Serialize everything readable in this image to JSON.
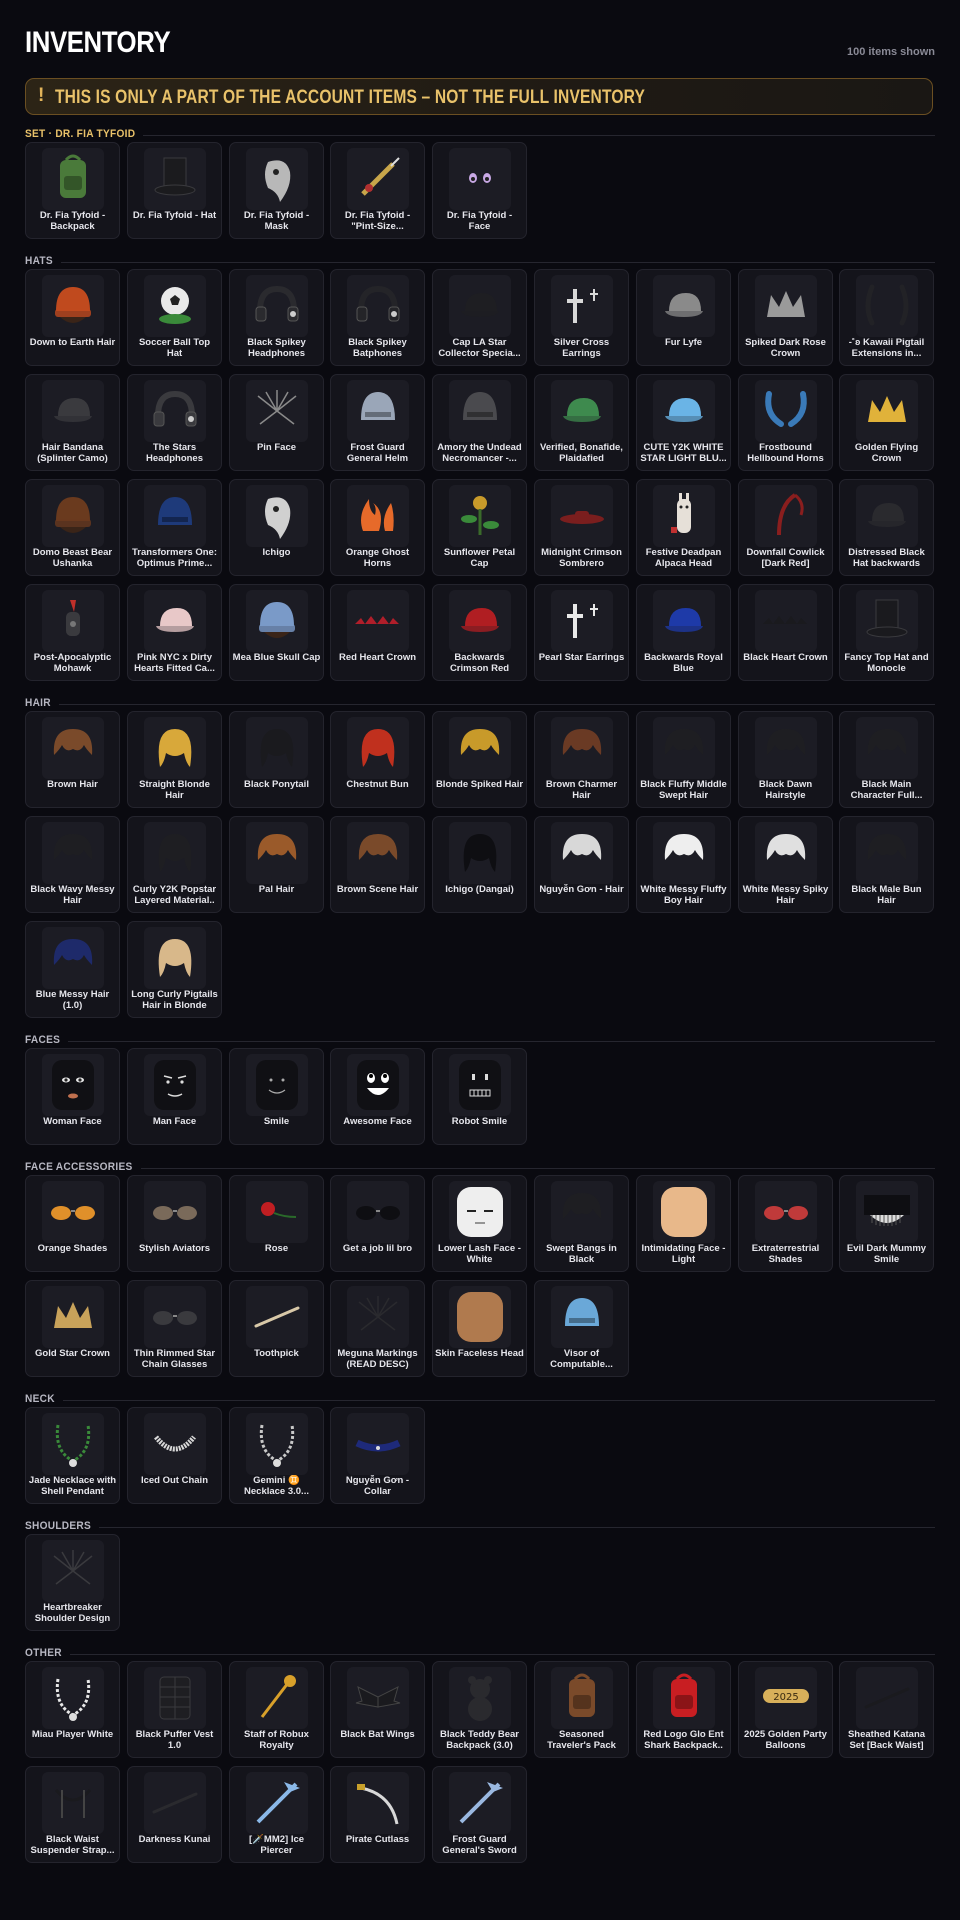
{
  "header": {
    "title": "INVENTORY",
    "count": "100 items shown"
  },
  "banner": {
    "icon": "!",
    "text": "THIS IS ONLY A PART OF THE ACCOUNT ITEMS – NOT THE FULL INVENTORY",
    "color": "#e9c26a"
  },
  "sections": [
    {
      "label": "SET · DR. FIA TYFOID",
      "highlight": true,
      "items": [
        {
          "name": "Dr. Fia Tyfoid - Backpack",
          "icon": "backpack",
          "c": "#4a7a3a"
        },
        {
          "name": "Dr. Fia Tyfoid - Hat",
          "icon": "tophat",
          "c": "#1b1b1e"
        },
        {
          "name": "Dr. Fia Tyfoid - Mask",
          "icon": "mask",
          "c": "#b8b8b8"
        },
        {
          "name": "Dr. Fia Tyfoid - \"Pint-Size...",
          "icon": "syringe",
          "c": "#c8a64a"
        },
        {
          "name": "Dr. Fia Tyfoid - Face",
          "icon": "face-eyes",
          "c": "#c9a9e6"
        }
      ]
    },
    {
      "label": "HATS",
      "highlight": false,
      "items": [
        {
          "name": "Down to Earth Hair",
          "icon": "beanie",
          "c": "#c04a1e"
        },
        {
          "name": "Soccer Ball Top Hat",
          "icon": "ball",
          "c": "#e9e9e9"
        },
        {
          "name": "Black Spikey Headphones",
          "icon": "headphones",
          "c": "#2a2a2e"
        },
        {
          "name": "Black Spikey Batphones",
          "icon": "headphones",
          "c": "#242428"
        },
        {
          "name": "Cap LA Star Collector Specia...",
          "icon": "cap",
          "c": "#1e1e22"
        },
        {
          "name": "Silver Cross Earrings",
          "icon": "cross",
          "c": "#d8d8d8"
        },
        {
          "name": "Fur Lyfe",
          "icon": "cap",
          "c": "#8a8a8a"
        },
        {
          "name": "Spiked Dark Rose Crown",
          "icon": "crown",
          "c": "#9a9a9a"
        },
        {
          "name": "-˚ʚ Kawaii Pigtail Extensions in...",
          "icon": "pigtails",
          "c": "#222226"
        },
        {
          "name": "Hair Bandana (Splinter Camo)",
          "icon": "cap",
          "c": "#3a3a3e"
        },
        {
          "name": "The Stars Headphones",
          "icon": "headphones",
          "c": "#3a3a3e"
        },
        {
          "name": "Pin Face",
          "icon": "lines",
          "c": "#8a8a8a"
        },
        {
          "name": "Frost Guard General Helm",
          "icon": "helm",
          "c": "#9aa6b8"
        },
        {
          "name": "Amory the Undead Necromancer -...",
          "icon": "helm",
          "c": "#4a4a4e"
        },
        {
          "name": "Verified, Bonafide, Plaidafied",
          "icon": "cap",
          "c": "#3e8a4e"
        },
        {
          "name": "CUTE Y2K WHITE STAR LIGHT BLU...",
          "icon": "cap",
          "c": "#6ab4e6"
        },
        {
          "name": "Frostbound Hellbound Horns",
          "icon": "horns",
          "c": "#3a7ab8"
        },
        {
          "name": "Golden Flying Crown",
          "icon": "crown",
          "c": "#e0b23a"
        },
        {
          "name": "Domo Beast Bear Ushanka",
          "icon": "beanie",
          "c": "#6a3a1e"
        },
        {
          "name": "Transformers One: Optimus Prime...",
          "icon": "helm",
          "c": "#1e3a7a"
        },
        {
          "name": "Ichigo",
          "icon": "mask",
          "c": "#d0d0d0"
        },
        {
          "name": "Orange Ghost Horns",
          "icon": "flame",
          "c": "#e66a2a"
        },
        {
          "name": "Sunflower Petal Cap",
          "icon": "plant",
          "c": "#3a8a3a"
        },
        {
          "name": "Midnight Crimson Sombrero",
          "icon": "hat-flat",
          "c": "#7a1e1e"
        },
        {
          "name": "Festive Deadpan Alpaca Head",
          "icon": "alpaca",
          "c": "#e6e0d8"
        },
        {
          "name": "Downfall Cowlick [Dark Red]",
          "icon": "scythe",
          "c": "#8a1e1e"
        },
        {
          "name": "Distressed Black Hat backwards",
          "icon": "cap",
          "c": "#2a2a2e"
        },
        {
          "name": "Post-Apocalyptic Mohawk",
          "icon": "mohawk",
          "c": "#c0302a"
        },
        {
          "name": "Pink NYC x Dirty Hearts Fitted Ca...",
          "icon": "cap",
          "c": "#e8c8c8"
        },
        {
          "name": "Mea Blue Skull Cap",
          "icon": "beanie",
          "c": "#7a9ac8"
        },
        {
          "name": "Red Heart Crown",
          "icon": "spikes",
          "c": "#b01e2a"
        },
        {
          "name": "Backwards Crimson Red",
          "icon": "cap",
          "c": "#b01e22"
        },
        {
          "name": "Pearl Star Earrings",
          "icon": "cross",
          "c": "#e8e8e8"
        },
        {
          "name": "Backwards Royal Blue",
          "icon": "cap",
          "c": "#1e3aa8"
        },
        {
          "name": "Black Heart Crown",
          "icon": "spikes",
          "c": "#1a1a1e"
        },
        {
          "name": "Fancy Top Hat and Monocle",
          "icon": "tophat",
          "c": "#1a1a1e"
        }
      ]
    },
    {
      "label": "HAIR",
      "highlight": false,
      "items": [
        {
          "name": "Brown Hair",
          "icon": "hair",
          "c": "#7a4a2a"
        },
        {
          "name": "Straight Blonde Hair",
          "icon": "hair-long",
          "c": "#d8a83a"
        },
        {
          "name": "Black Ponytail",
          "icon": "hair-long",
          "c": "#1a1a1e"
        },
        {
          "name": "Chestnut Bun",
          "icon": "hair-long",
          "c": "#c0301e"
        },
        {
          "name": "Blonde Spiked Hair",
          "icon": "hair",
          "c": "#c89a2a"
        },
        {
          "name": "Brown Charmer Hair",
          "icon": "hair",
          "c": "#6a3a24"
        },
        {
          "name": "Black Fluffy Middle Swept Hair",
          "icon": "hair",
          "c": "#1e1e22"
        },
        {
          "name": "Black Dawn Hairstyle",
          "icon": "hair",
          "c": "#1e1e22"
        },
        {
          "name": "Black Main Character Full...",
          "icon": "hair",
          "c": "#1e1e22"
        },
        {
          "name": "Black Wavy Messy Hair",
          "icon": "hair",
          "c": "#1e1e22"
        },
        {
          "name": "Curly Y2K Popstar Layered Material..",
          "icon": "hair-long",
          "c": "#1e1e22"
        },
        {
          "name": "Pal Hair",
          "icon": "hair",
          "c": "#9a5a2a"
        },
        {
          "name": "Brown Scene Hair",
          "icon": "hair",
          "c": "#7a4a2a"
        },
        {
          "name": "Ichigo (Dangai)",
          "icon": "hair-long",
          "c": "#0e0e12"
        },
        {
          "name": "Nguyễn Gơn - Hair",
          "icon": "hair",
          "c": "#d8d8d8"
        },
        {
          "name": "White Messy Fluffy Boy Hair",
          "icon": "hair",
          "c": "#eeeeee"
        },
        {
          "name": "White Messy Spiky Hair",
          "icon": "hair",
          "c": "#e0e0e0"
        },
        {
          "name": "Black Male Bun Hair",
          "icon": "hair",
          "c": "#1e1e22"
        },
        {
          "name": "Blue Messy Hair (1.0)",
          "icon": "hair",
          "c": "#1e2a6a"
        },
        {
          "name": "Long Curly Pigtails Hair in Blonde",
          "icon": "hair-long",
          "c": "#d8b88a"
        }
      ]
    },
    {
      "label": "FACES",
      "highlight": false,
      "items": [
        {
          "name": "Woman Face",
          "icon": "face-woman",
          "c": "#101014"
        },
        {
          "name": "Man Face",
          "icon": "face-man",
          "c": "#101014"
        },
        {
          "name": "Smile",
          "icon": "face-smile",
          "c": "#101014"
        },
        {
          "name": "Awesome Face",
          "icon": "face-awesome",
          "c": "#101014"
        },
        {
          "name": "Robot Smile",
          "icon": "face-robot",
          "c": "#101014"
        }
      ]
    },
    {
      "label": "FACE ACCESSORIES",
      "highlight": false,
      "items": [
        {
          "name": "Orange Shades",
          "icon": "glasses",
          "c": "#e0902a"
        },
        {
          "name": "Stylish Aviators",
          "icon": "glasses",
          "c": "#7a6a5a"
        },
        {
          "name": "Rose",
          "icon": "rose",
          "c": "#c01e22"
        },
        {
          "name": "Get a job lil bro",
          "icon": "glasses",
          "c": "#0e0e12"
        },
        {
          "name": "Lower Lash Face - White",
          "icon": "head-white",
          "c": "#eeeeee"
        },
        {
          "name": "Swept Bangs in Black",
          "icon": "hair",
          "c": "#1e1e22"
        },
        {
          "name": "Intimidating Face - Light",
          "icon": "head-skin",
          "c": "#e8b88a"
        },
        {
          "name": "Extraterrestrial Shades",
          "icon": "glasses",
          "c": "#c03a3a"
        },
        {
          "name": "Evil Dark Mummy Smile",
          "icon": "mummy",
          "c": "#0e0e12"
        },
        {
          "name": "Gold Star Crown",
          "icon": "crown",
          "c": "#c8a25a"
        },
        {
          "name": "Thin Rimmed Star Chain Glasses",
          "icon": "glasses",
          "c": "#3a3a3e"
        },
        {
          "name": "Toothpick",
          "icon": "stick",
          "c": "#d8c8a8"
        },
        {
          "name": "Meguna Markings (READ DESC)",
          "icon": "lines",
          "c": "#2a2a2e"
        },
        {
          "name": "Skin Faceless Head",
          "icon": "head-skin",
          "c": "#b07a4e"
        },
        {
          "name": "Visor of Computable...",
          "icon": "helm",
          "c": "#6aa8d8"
        }
      ]
    },
    {
      "label": "NECK",
      "highlight": false,
      "items": [
        {
          "name": "Jade Necklace with Shell Pendant",
          "icon": "necklace",
          "c": "#3a8a3a"
        },
        {
          "name": "Iced Out Chain",
          "icon": "chain",
          "c": "#d8d8d8"
        },
        {
          "name": "Gemini ♊ Necklace 3.0...",
          "icon": "necklace",
          "c": "#c8c8c8"
        },
        {
          "name": "Nguyễn Gơn - Collar",
          "icon": "collar",
          "c": "#1e2a7a"
        }
      ]
    },
    {
      "label": "SHOULDERS",
      "highlight": false,
      "items": [
        {
          "name": "Heartbreaker Shoulder Design",
          "icon": "lines",
          "c": "#3a3a3e"
        }
      ]
    },
    {
      "label": "OTHER",
      "highlight": false,
      "items": [
        {
          "name": "Miau Player White",
          "icon": "necklace",
          "c": "#e8e8e8"
        },
        {
          "name": "Black Puffer Vest 1.0",
          "icon": "vest",
          "c": "#1e1e22"
        },
        {
          "name": "Staff of Robux Royalty",
          "icon": "staff",
          "c": "#d8a02a"
        },
        {
          "name": "Black Bat Wings",
          "icon": "wings",
          "c": "#1a1a1e"
        },
        {
          "name": "Black Teddy Bear Backpack (3.0)",
          "icon": "bear",
          "c": "#2a2a2e"
        },
        {
          "name": "Seasoned Traveler's Pack",
          "icon": "backpack",
          "c": "#7a4a2a"
        },
        {
          "name": "Red Logo Glo Ent Shark Backpack..",
          "icon": "backpack",
          "c": "#c81e22"
        },
        {
          "name": "2025 Golden Party Balloons",
          "icon": "balloons",
          "c": "#d8b05a"
        },
        {
          "name": "Sheathed Katana Set [Back Waist]",
          "icon": "stick",
          "c": "#1a1a1e"
        },
        {
          "name": "Black Waist Suspender Strap...",
          "icon": "strap",
          "c": "#1a1a1e"
        },
        {
          "name": "Darkness Kunai",
          "icon": "stick",
          "c": "#2a2a2e"
        },
        {
          "name": "[🗡️MM2] Ice Piercer",
          "icon": "icesword",
          "c": "#8ab8e8"
        },
        {
          "name": "Pirate Cutlass",
          "icon": "cutlass",
          "c": "#d8d8d8"
        },
        {
          "name": "Frost Guard General's Sword",
          "icon": "icesword",
          "c": "#9ab8e0"
        }
      ]
    }
  ]
}
